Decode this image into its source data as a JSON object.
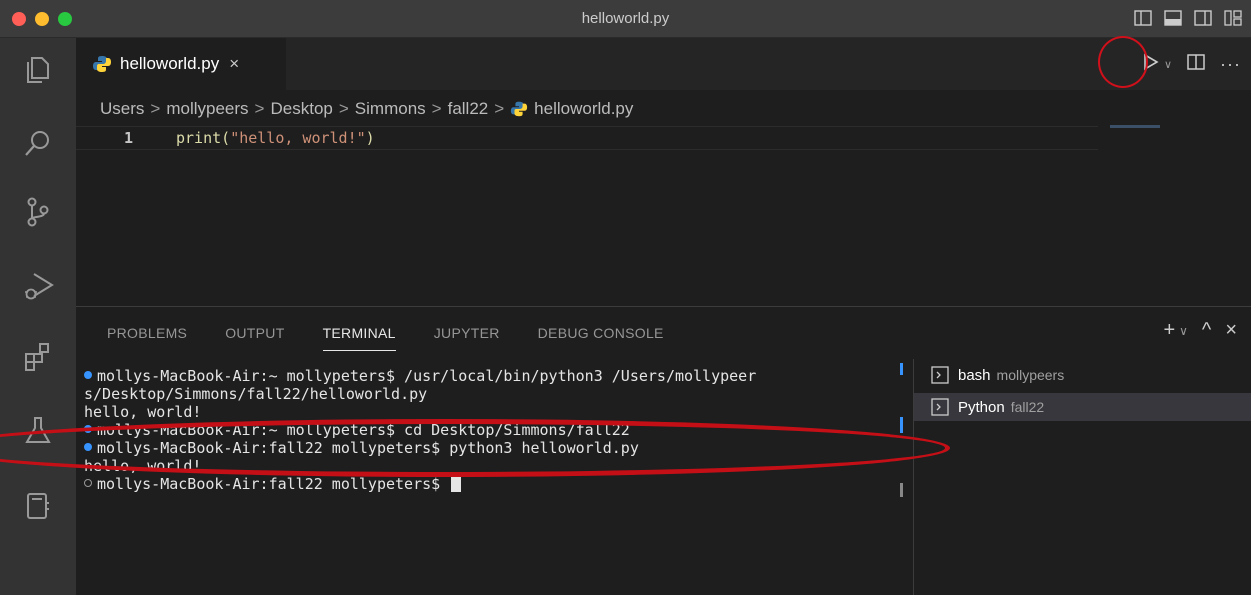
{
  "window": {
    "title": "helloworld.py"
  },
  "tab": {
    "label": "helloworld.py",
    "close": "×"
  },
  "breadcrumb": [
    "Users",
    "mollypeers",
    "Desktop",
    "Simmons",
    "fall22",
    "helloworld.py"
  ],
  "breadcrumb_sep": ">",
  "editor": {
    "line_number": "1",
    "code_fn": "print(",
    "code_str": "\"hello, world!\"",
    "code_end": ")"
  },
  "editor_actions": {
    "more": "···"
  },
  "panel": {
    "tabs": [
      "PROBLEMS",
      "OUTPUT",
      "TERMINAL",
      "JUPYTER",
      "DEBUG CONSOLE"
    ],
    "active_tab": "TERMINAL",
    "actions": {
      "add": "+",
      "chevron": "∨",
      "maximize": "^",
      "close": "×"
    }
  },
  "terminal": {
    "lines": [
      "mollys-MacBook-Air:~ mollypeters$ /usr/local/bin/python3 /Users/mollypeer",
      "s/Desktop/Simmons/fall22/helloworld.py",
      "hello, world!",
      "mollys-MacBook-Air:~ mollypeters$ cd Desktop/Simmons/fall22",
      "mollys-MacBook-Air:fall22 mollypeters$ python3 helloworld.py",
      "hello, world!",
      "mollys-MacBook-Air:fall22 mollypeters$ "
    ]
  },
  "terminal_list": [
    {
      "name": "bash",
      "desc": "mollypeers"
    },
    {
      "name": "Python",
      "desc": "fall22"
    }
  ],
  "colors": {
    "annotation_red": "#c40f17",
    "accent": "#3794ff"
  }
}
